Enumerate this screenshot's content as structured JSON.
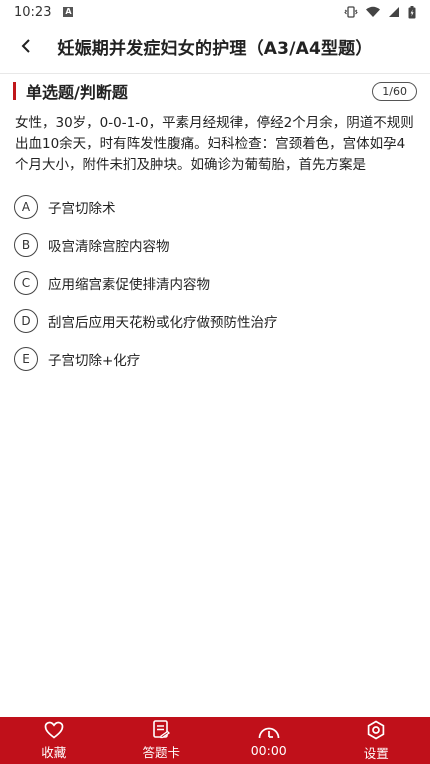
{
  "status_bar": {
    "time": "10:23",
    "notification_glyph": "A"
  },
  "header": {
    "title": "妊娠期并发症妇女的护理（A3/A4型题）"
  },
  "section": {
    "title": "单选题/判断题",
    "progress": "1/60"
  },
  "question": {
    "text": "女性，30岁，0-0-1-0，平素月经规律，停经2个月余，阴道不规则出血10余天，时有阵发性腹痛。妇科检查：宫颈着色，宫体如孕4个月大小，附件未扪及肿块。如确诊为葡萄胎，首先方案是"
  },
  "options": [
    {
      "letter": "A",
      "text": "子宫切除术"
    },
    {
      "letter": "B",
      "text": "吸宫清除宫腔内容物"
    },
    {
      "letter": "C",
      "text": "应用缩宫素促使排清内容物"
    },
    {
      "letter": "D",
      "text": "刮宫后应用天花粉或化疗做预防性治疗"
    },
    {
      "letter": "E",
      "text": "子宫切除+化疗"
    }
  ],
  "bottom_bar": {
    "favorite_label": "收藏",
    "answer_card_label": "答题卡",
    "timer_label": "00:00",
    "settings_label": "设置"
  },
  "colors": {
    "accent": "#c0101a",
    "section_bar": "#c0171b"
  }
}
